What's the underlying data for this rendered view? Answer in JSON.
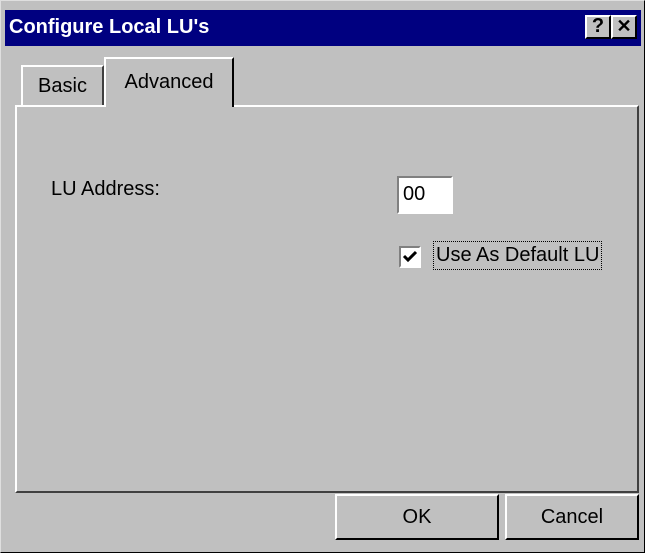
{
  "window": {
    "title": "Configure Local LU's",
    "help_glyph": "?",
    "close_glyph": "✕"
  },
  "tabs": [
    {
      "label": "Basic",
      "selected": false
    },
    {
      "label": "Advanced",
      "selected": true
    }
  ],
  "advanced": {
    "lu_address_label": "LU Address:",
    "lu_address_value": "00",
    "default_lu_label": "Use As Default LU",
    "default_lu_checked": true
  },
  "buttons": {
    "ok_label": "OK",
    "cancel_label": "Cancel"
  },
  "colors": {
    "titlebar": "#000080",
    "face": "#c0c0c0"
  }
}
